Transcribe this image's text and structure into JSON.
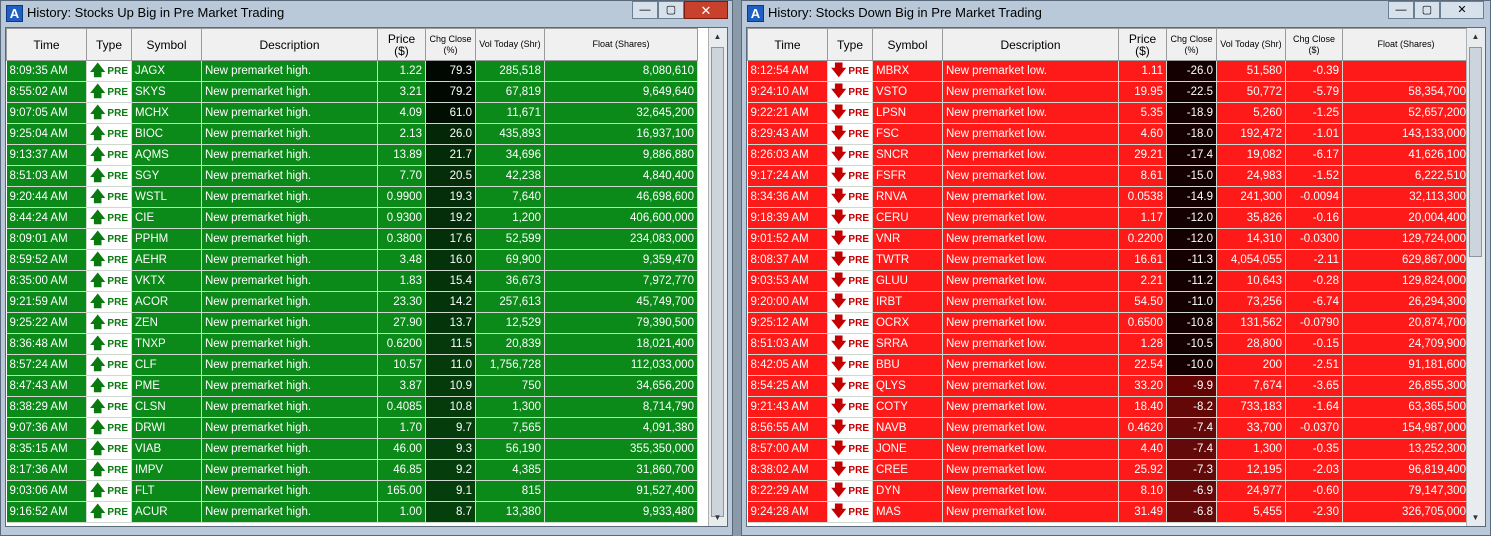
{
  "left": {
    "title": "History:  Stocks Up Big in Pre Market Trading",
    "columns": [
      "Time",
      "Type",
      "Symbol",
      "Description",
      "Price ($)",
      "Chg Close (%)",
      "Vol Today (Shr)",
      "Float (Shares)"
    ],
    "rows": [
      {
        "time": "8:09:35 AM",
        "type": "PRE",
        "symbol": "JAGX",
        "desc": "New premarket high.",
        "price": "1.22",
        "chg": "79.3",
        "vol": "285,518",
        "float": "8,080,610"
      },
      {
        "time": "8:55:02 AM",
        "type": "PRE",
        "symbol": "SKYS",
        "desc": "New premarket high.",
        "price": "3.21",
        "chg": "79.2",
        "vol": "67,819",
        "float": "9,649,640"
      },
      {
        "time": "9:07:05 AM",
        "type": "PRE",
        "symbol": "MCHX",
        "desc": "New premarket high.",
        "price": "4.09",
        "chg": "61.0",
        "vol": "11,671",
        "float": "32,645,200"
      },
      {
        "time": "9:25:04 AM",
        "type": "PRE",
        "symbol": "BIOC",
        "desc": "New premarket high.",
        "price": "2.13",
        "chg": "26.0",
        "vol": "435,893",
        "float": "16,937,100"
      },
      {
        "time": "9:13:37 AM",
        "type": "PRE",
        "symbol": "AQMS",
        "desc": "New premarket high.",
        "price": "13.89",
        "chg": "21.7",
        "vol": "34,696",
        "float": "9,886,880"
      },
      {
        "time": "8:51:03 AM",
        "type": "PRE",
        "symbol": "SGY",
        "desc": "New premarket high.",
        "price": "7.70",
        "chg": "20.5",
        "vol": "42,238",
        "float": "4,840,400"
      },
      {
        "time": "9:20:44 AM",
        "type": "PRE",
        "symbol": "WSTL",
        "desc": "New premarket high.",
        "price": "0.9900",
        "chg": "19.3",
        "vol": "7,640",
        "float": "46,698,600"
      },
      {
        "time": "8:44:24 AM",
        "type": "PRE",
        "symbol": "CIE",
        "desc": "New premarket high.",
        "price": "0.9300",
        "chg": "19.2",
        "vol": "1,200",
        "float": "406,600,000"
      },
      {
        "time": "8:09:01 AM",
        "type": "PRE",
        "symbol": "PPHM",
        "desc": "New premarket high.",
        "price": "0.3800",
        "chg": "17.6",
        "vol": "52,599",
        "float": "234,083,000"
      },
      {
        "time": "8:59:52 AM",
        "type": "PRE",
        "symbol": "AEHR",
        "desc": "New premarket high.",
        "price": "3.48",
        "chg": "16.0",
        "vol": "69,900",
        "float": "9,359,470"
      },
      {
        "time": "8:35:00 AM",
        "type": "PRE",
        "symbol": "VKTX",
        "desc": "New premarket high.",
        "price": "1.83",
        "chg": "15.4",
        "vol": "36,673",
        "float": "7,972,770"
      },
      {
        "time": "9:21:59 AM",
        "type": "PRE",
        "symbol": "ACOR",
        "desc": "New premarket high.",
        "price": "23.30",
        "chg": "14.2",
        "vol": "257,613",
        "float": "45,749,700"
      },
      {
        "time": "9:25:22 AM",
        "type": "PRE",
        "symbol": "ZEN",
        "desc": "New premarket high.",
        "price": "27.90",
        "chg": "13.7",
        "vol": "12,529",
        "float": "79,390,500"
      },
      {
        "time": "8:36:48 AM",
        "type": "PRE",
        "symbol": "TNXP",
        "desc": "New premarket high.",
        "price": "0.6200",
        "chg": "11.5",
        "vol": "20,839",
        "float": "18,021,400"
      },
      {
        "time": "8:57:24 AM",
        "type": "PRE",
        "symbol": "CLF",
        "desc": "New premarket high.",
        "price": "10.57",
        "chg": "11.0",
        "vol": "1,756,728",
        "float": "112,033,000"
      },
      {
        "time": "8:47:43 AM",
        "type": "PRE",
        "symbol": "PME",
        "desc": "New premarket high.",
        "price": "3.87",
        "chg": "10.9",
        "vol": "750",
        "float": "34,656,200"
      },
      {
        "time": "8:38:29 AM",
        "type": "PRE",
        "symbol": "CLSN",
        "desc": "New premarket high.",
        "price": "0.4085",
        "chg": "10.8",
        "vol": "1,300",
        "float": "8,714,790"
      },
      {
        "time": "9:07:36 AM",
        "type": "PRE",
        "symbol": "DRWI",
        "desc": "New premarket high.",
        "price": "1.70",
        "chg": "9.7",
        "vol": "7,565",
        "float": "4,091,380"
      },
      {
        "time": "8:35:15 AM",
        "type": "PRE",
        "symbol": "VIAB",
        "desc": "New premarket high.",
        "price": "46.00",
        "chg": "9.3",
        "vol": "56,190",
        "float": "355,350,000"
      },
      {
        "time": "8:17:36 AM",
        "type": "PRE",
        "symbol": "IMPV",
        "desc": "New premarket high.",
        "price": "46.85",
        "chg": "9.2",
        "vol": "4,385",
        "float": "31,860,700"
      },
      {
        "time": "9:03:06 AM",
        "type": "PRE",
        "symbol": "FLT",
        "desc": "New premarket high.",
        "price": "165.00",
        "chg": "9.1",
        "vol": "815",
        "float": "91,527,400"
      },
      {
        "time": "9:16:52 AM",
        "type": "PRE",
        "symbol": "ACUR",
        "desc": "New premarket high.",
        "price": "1.00",
        "chg": "8.7",
        "vol": "13,380",
        "float": "9,933,480"
      }
    ]
  },
  "right": {
    "title": "History:  Stocks Down Big in Pre Market Trading",
    "columns": [
      "Time",
      "Type",
      "Symbol",
      "Description",
      "Price ($)",
      "Chg Close (%)",
      "Vol Today (Shr)",
      "Chg Close ($)",
      "Float (Shares)"
    ],
    "rows": [
      {
        "time": "8:12:54 AM",
        "type": "PRE",
        "symbol": "MBRX",
        "desc": "New premarket low.",
        "price": "1.11",
        "chg": "-26.0",
        "vol": "51,580",
        "chgd": "-0.39",
        "float": ""
      },
      {
        "time": "9:24:10 AM",
        "type": "PRE",
        "symbol": "VSTO",
        "desc": "New premarket low.",
        "price": "19.95",
        "chg": "-22.5",
        "vol": "50,772",
        "chgd": "-5.79",
        "float": "58,354,700"
      },
      {
        "time": "9:22:21 AM",
        "type": "PRE",
        "symbol": "LPSN",
        "desc": "New premarket low.",
        "price": "5.35",
        "chg": "-18.9",
        "vol": "5,260",
        "chgd": "-1.25",
        "float": "52,657,200"
      },
      {
        "time": "8:29:43 AM",
        "type": "PRE",
        "symbol": "FSC",
        "desc": "New premarket low.",
        "price": "4.60",
        "chg": "-18.0",
        "vol": "192,472",
        "chgd": "-1.01",
        "float": "143,133,000"
      },
      {
        "time": "8:26:03 AM",
        "type": "PRE",
        "symbol": "SNCR",
        "desc": "New premarket low.",
        "price": "29.21",
        "chg": "-17.4",
        "vol": "19,082",
        "chgd": "-6.17",
        "float": "41,626,100"
      },
      {
        "time": "9:17:24 AM",
        "type": "PRE",
        "symbol": "FSFR",
        "desc": "New premarket low.",
        "price": "8.61",
        "chg": "-15.0",
        "vol": "24,983",
        "chgd": "-1.52",
        "float": "6,222,510"
      },
      {
        "time": "8:34:36 AM",
        "type": "PRE",
        "symbol": "RNVA",
        "desc": "New premarket low.",
        "price": "0.0538",
        "chg": "-14.9",
        "vol": "241,300",
        "chgd": "-0.0094",
        "float": "32,113,300"
      },
      {
        "time": "9:18:39 AM",
        "type": "PRE",
        "symbol": "CERU",
        "desc": "New premarket low.",
        "price": "1.17",
        "chg": "-12.0",
        "vol": "35,826",
        "chgd": "-0.16",
        "float": "20,004,400"
      },
      {
        "time": "9:01:52 AM",
        "type": "PRE",
        "symbol": "VNR",
        "desc": "New premarket low.",
        "price": "0.2200",
        "chg": "-12.0",
        "vol": "14,310",
        "chgd": "-0.0300",
        "float": "129,724,000"
      },
      {
        "time": "8:08:37 AM",
        "type": "PRE",
        "symbol": "TWTR",
        "desc": "New premarket low.",
        "price": "16.61",
        "chg": "-11.3",
        "vol": "4,054,055",
        "chgd": "-2.11",
        "float": "629,867,000"
      },
      {
        "time": "9:03:53 AM",
        "type": "PRE",
        "symbol": "GLUU",
        "desc": "New premarket low.",
        "price": "2.21",
        "chg": "-11.2",
        "vol": "10,643",
        "chgd": "-0.28",
        "float": "129,824,000"
      },
      {
        "time": "9:20:00 AM",
        "type": "PRE",
        "symbol": "IRBT",
        "desc": "New premarket low.",
        "price": "54.50",
        "chg": "-11.0",
        "vol": "73,256",
        "chgd": "-6.74",
        "float": "26,294,300"
      },
      {
        "time": "9:25:12 AM",
        "type": "PRE",
        "symbol": "OCRX",
        "desc": "New premarket low.",
        "price": "0.6500",
        "chg": "-10.8",
        "vol": "131,562",
        "chgd": "-0.0790",
        "float": "20,874,700"
      },
      {
        "time": "8:51:03 AM",
        "type": "PRE",
        "symbol": "SRRA",
        "desc": "New premarket low.",
        "price": "1.28",
        "chg": "-10.5",
        "vol": "28,800",
        "chgd": "-0.15",
        "float": "24,709,900"
      },
      {
        "time": "8:42:05 AM",
        "type": "PRE",
        "symbol": "BBU",
        "desc": "New premarket low.",
        "price": "22.54",
        "chg": "-10.0",
        "vol": "200",
        "chgd": "-2.51",
        "float": "91,181,600"
      },
      {
        "time": "8:54:25 AM",
        "type": "PRE",
        "symbol": "QLYS",
        "desc": "New premarket low.",
        "price": "33.20",
        "chg": "-9.9",
        "vol": "7,674",
        "chgd": "-3.65",
        "float": "26,855,300"
      },
      {
        "time": "9:21:43 AM",
        "type": "PRE",
        "symbol": "COTY",
        "desc": "New premarket low.",
        "price": "18.40",
        "chg": "-8.2",
        "vol": "733,183",
        "chgd": "-1.64",
        "float": "63,365,500"
      },
      {
        "time": "8:56:55 AM",
        "type": "PRE",
        "symbol": "NAVB",
        "desc": "New premarket low.",
        "price": "0.4620",
        "chg": "-7.4",
        "vol": "33,700",
        "chgd": "-0.0370",
        "float": "154,987,000"
      },
      {
        "time": "8:57:00 AM",
        "type": "PRE",
        "symbol": "JONE",
        "desc": "New premarket low.",
        "price": "4.40",
        "chg": "-7.4",
        "vol": "1,300",
        "chgd": "-0.35",
        "float": "13,252,300"
      },
      {
        "time": "8:38:02 AM",
        "type": "PRE",
        "symbol": "CREE",
        "desc": "New premarket low.",
        "price": "25.92",
        "chg": "-7.3",
        "vol": "12,195",
        "chgd": "-2.03",
        "float": "96,819,400"
      },
      {
        "time": "8:22:29 AM",
        "type": "PRE",
        "symbol": "DYN",
        "desc": "New premarket low.",
        "price": "8.10",
        "chg": "-6.9",
        "vol": "24,977",
        "chgd": "-0.60",
        "float": "79,147,300"
      },
      {
        "time": "9:24:28 AM",
        "type": "PRE",
        "symbol": "MAS",
        "desc": "New premarket low.",
        "price": "31.49",
        "chg": "-6.8",
        "vol": "5,455",
        "chgd": "-2.30",
        "float": "326,705,000"
      }
    ]
  },
  "icons": {
    "app": "A",
    "minimize": "—",
    "maximize": "▢",
    "close": "✕",
    "up_arrow": "🡅",
    "down_arrow": "🡇"
  },
  "colors": {
    "up_row": "#0b8a1a",
    "down_row": "#ff1a1a",
    "chg_dark": "#000000"
  }
}
